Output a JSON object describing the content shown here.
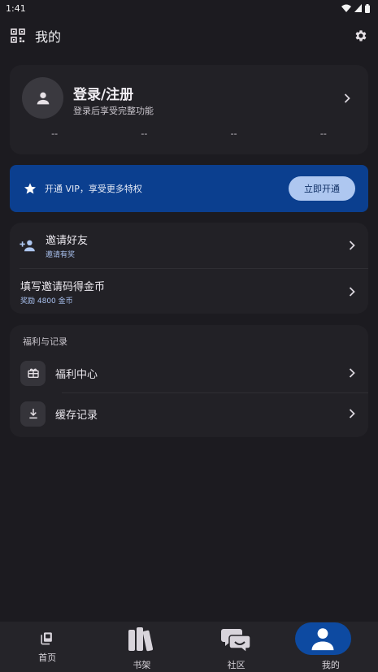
{
  "status_bar": {
    "time": "1:41"
  },
  "app_bar": {
    "title": "我的"
  },
  "profile": {
    "login_title": "登录/注册",
    "login_subtitle": "登录后享受完整功能",
    "stats": [
      "--",
      "--",
      "--",
      "--"
    ]
  },
  "vip": {
    "text": "开通 VIP，享受更多特权",
    "button": "立即开通"
  },
  "invite": {
    "friends_title": "邀请好友",
    "friends_sub": "邀请有奖",
    "code_title": "填写邀请码得金币",
    "code_sub": "奖励 4800 金币"
  },
  "welfare": {
    "section_title": "福利与记录",
    "items": [
      {
        "label": "福利中心",
        "icon": "gift-icon"
      },
      {
        "label": "缓存记录",
        "icon": "download-icon"
      }
    ]
  },
  "bottom_nav": {
    "items": [
      {
        "label": "首页",
        "icon": "home-book-icon"
      },
      {
        "label": "书架",
        "icon": "bookshelf-icon"
      },
      {
        "label": "社区",
        "icon": "community-icon"
      },
      {
        "label": "我的",
        "icon": "profile-icon",
        "active": true
      }
    ]
  },
  "colors": {
    "background": "#1c1b20",
    "card": "#222126",
    "vip_banner": "#0b3f8f",
    "vip_button": "#aec7f0",
    "accent_text": "#a9c1ef",
    "nav_active_pill": "#0d4aa1"
  }
}
